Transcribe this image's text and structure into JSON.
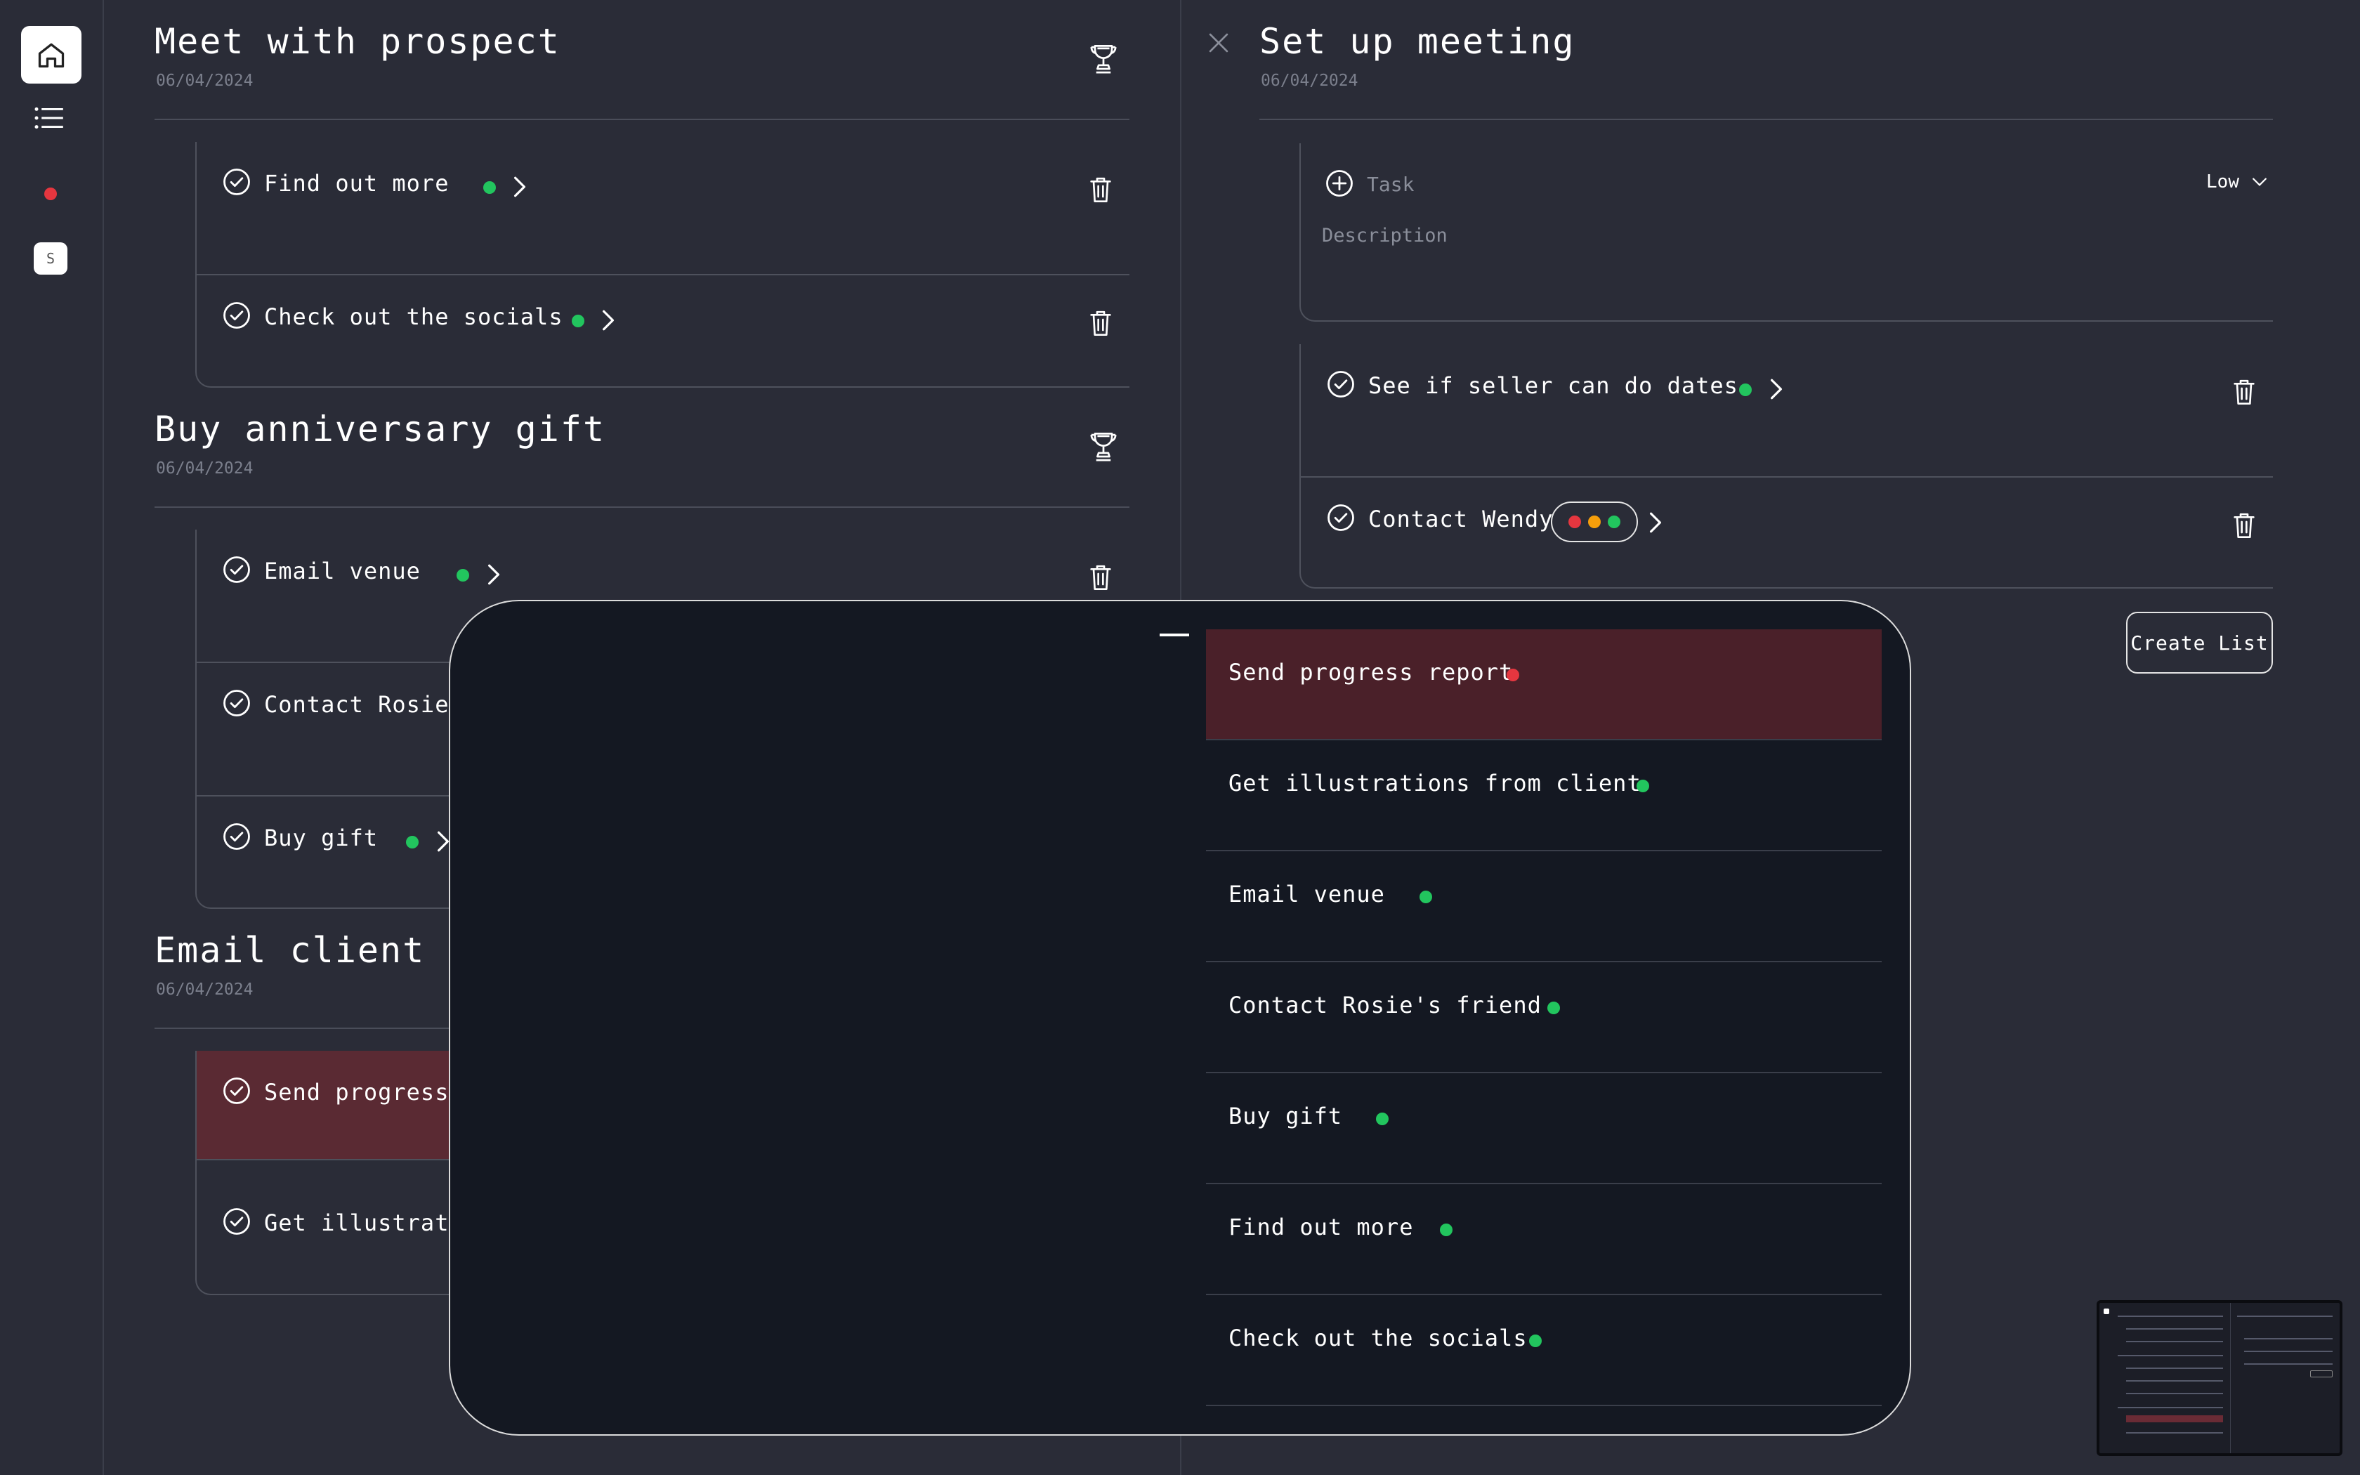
{
  "colors": {
    "background": "#2a2c37",
    "overlay": "#141822",
    "highlight": "#5a2a33",
    "status_green": "#22c55e",
    "status_red": "#e5363f",
    "status_orange": "#f59e0b"
  },
  "sidebar": {
    "avatar_letter": "S"
  },
  "lists": [
    {
      "title": "Meet with prospect",
      "date": "06/04/2024",
      "tasks": [
        {
          "label": "Find out more"
        },
        {
          "label": "Check out the socials"
        }
      ]
    },
    {
      "title": "Buy anniversary gift",
      "date": "06/04/2024",
      "tasks": [
        {
          "label": "Email venue"
        },
        {
          "label": "Contact Rosie's"
        },
        {
          "label": "Buy gift"
        }
      ]
    },
    {
      "title": "Email client",
      "date": "06/04/2024",
      "tasks": [
        {
          "label": "Send progress r"
        },
        {
          "label": "Get illustratio"
        }
      ]
    }
  ],
  "editor": {
    "title": "Set up meeting",
    "date": "06/04/2024",
    "task_placeholder": "Task",
    "priority": "Low",
    "description_placeholder": "Description",
    "tasks": [
      {
        "label": "See if seller can do dates"
      },
      {
        "label": "Contact Wendy"
      }
    ],
    "create_button": "Create List"
  },
  "dropdown": {
    "items": [
      {
        "label": "Send progress report",
        "status": "red"
      },
      {
        "label": "Get illustrations from client",
        "status": "green"
      },
      {
        "label": "Email venue",
        "status": "green"
      },
      {
        "label": "Contact Rosie's friend",
        "status": "green"
      },
      {
        "label": "Buy gift",
        "status": "green"
      },
      {
        "label": "Find out more",
        "status": "green"
      },
      {
        "label": "Check out the socials",
        "status": "green"
      }
    ]
  }
}
